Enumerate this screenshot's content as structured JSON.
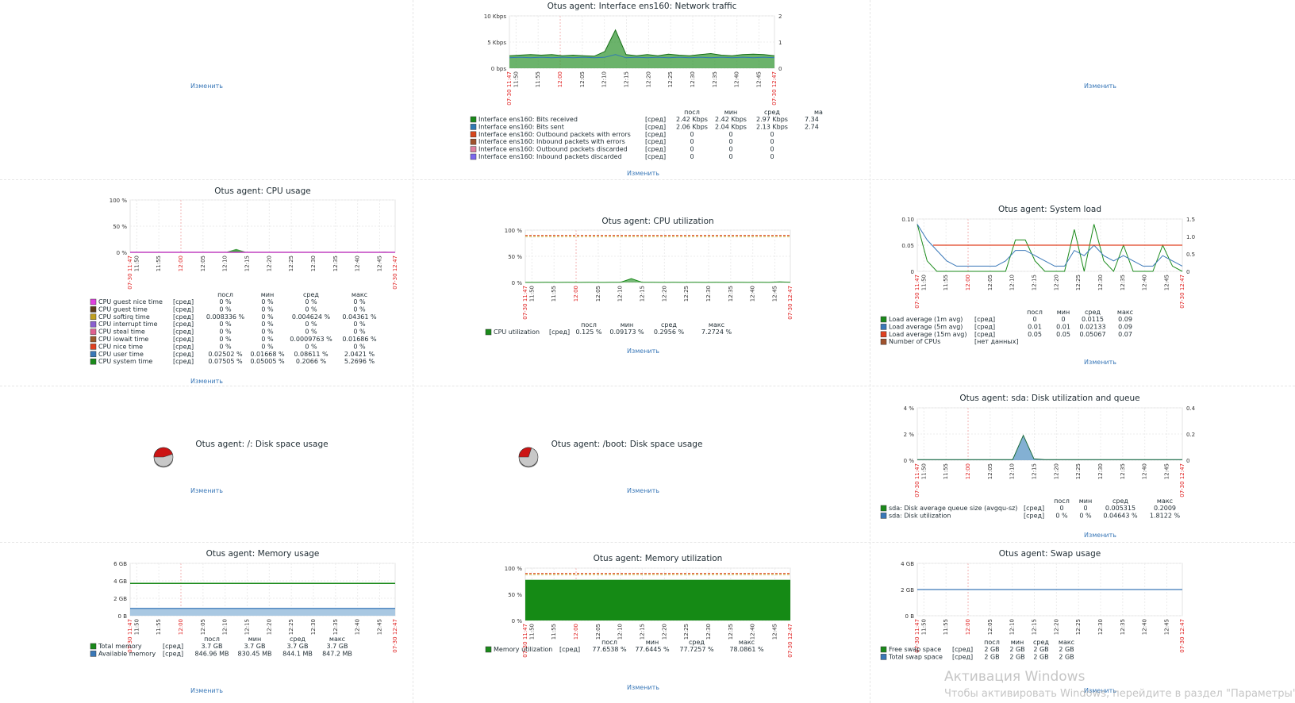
{
  "common": {
    "edit_label": "Изменить",
    "time_start": "07-30 11:47",
    "time_end": "07-30 12:47",
    "time_ticks": [
      "11:50",
      "11:55",
      "12:00",
      "12:05",
      "12:10",
      "12:15",
      "12:20",
      "12:25",
      "12:30",
      "12:35",
      "12:40",
      "12:45"
    ],
    "red_tick": "12:00",
    "func_avg": "[сред]",
    "func_nodata": "[нет данных]",
    "cols": [
      "посл",
      "мин",
      "сред",
      "макс"
    ],
    "col_header_cut": "ма"
  },
  "watermark": {
    "line1": "Активация Windows",
    "line2": "Чтобы активировать Windows, перейдите в раздел \"Параметры\"."
  },
  "charts": {
    "network": {
      "title": "Otus agent: Interface ens160: Network traffic",
      "y_left": [
        "10 Kbps",
        "5 Kbps",
        "0 bps"
      ],
      "y_right": [
        "2",
        "1",
        "0"
      ],
      "ylim_left_kbps": [
        0,
        10
      ],
      "series": [
        {
          "name": "Interface ens160: Bits received",
          "color": "#1a8a1a",
          "values": [
            "2.42 Kbps",
            "2.42 Kbps",
            "2.97 Kbps",
            "7.34"
          ]
        },
        {
          "name": "Interface ens160: Bits sent",
          "color": "#2f79b3",
          "values": [
            "2.06 Kbps",
            "2.04 Kbps",
            "2.13 Kbps",
            "2.74"
          ]
        },
        {
          "name": "Interface ens160: Outbound packets with errors",
          "color": "#d8461c",
          "values": [
            "0",
            "0",
            "0",
            ""
          ]
        },
        {
          "name": "Interface ens160: Inbound packets with errors",
          "color": "#a0522d",
          "values": [
            "0",
            "0",
            "0",
            ""
          ]
        },
        {
          "name": "Interface ens160: Outbound packets discarded",
          "color": "#e07fa0",
          "values": [
            "0",
            "0",
            "0",
            ""
          ]
        },
        {
          "name": "Interface ens160: Inbound packets discarded",
          "color": "#7b68ee",
          "values": [
            "0",
            "0",
            "0",
            ""
          ]
        }
      ],
      "received_kbps": [
        2.4,
        2.5,
        2.6,
        2.5,
        2.6,
        2.4,
        2.5,
        2.4,
        2.3,
        3.2,
        7.3,
        2.6,
        2.4,
        2.6,
        2.4,
        2.7,
        2.5,
        2.4,
        2.6,
        2.8,
        2.5,
        2.4,
        2.6,
        2.7,
        2.6,
        2.4
      ],
      "sent_kbps": [
        2.0,
        2.1,
        2.0,
        2.1,
        2.0,
        2.1,
        2.0,
        2.1,
        2.0,
        2.1,
        2.6,
        2.0,
        2.1,
        2.0,
        2.1,
        2.0,
        2.1,
        2.0,
        2.1,
        2.0,
        2.1,
        2.0,
        2.1,
        2.0,
        2.1,
        2.0
      ]
    },
    "cpu_usage": {
      "title": "Otus agent: CPU usage",
      "y_left": [
        "100 %",
        "50 %",
        "0 %"
      ],
      "series": [
        {
          "name": "CPU guest nice time",
          "color": "#e040e0",
          "values": [
            "0 %",
            "0 %",
            "0 %",
            "0 %"
          ]
        },
        {
          "name": "CPU guest time",
          "color": "#5a3a1a",
          "values": [
            "0 %",
            "0 %",
            "0 %",
            "0 %"
          ]
        },
        {
          "name": "CPU softirq time",
          "color": "#c0a020",
          "values": [
            "0.008336 %",
            "0 %",
            "0.004624 %",
            "0.04361 %"
          ]
        },
        {
          "name": "CPU interrupt time",
          "color": "#8a60d0",
          "values": [
            "0 %",
            "0 %",
            "0 %",
            "0 %"
          ]
        },
        {
          "name": "CPU steal time",
          "color": "#e06090",
          "values": [
            "0 %",
            "0 %",
            "0 %",
            "0 %"
          ]
        },
        {
          "name": "CPU iowait time",
          "color": "#9a5a2a",
          "values": [
            "0 %",
            "0 %",
            "0.0009763 %",
            "0.01686 %"
          ]
        },
        {
          "name": "CPU nice time",
          "color": "#e04020",
          "values": [
            "0 %",
            "0 %",
            "0 %",
            "0 %"
          ]
        },
        {
          "name": "CPU user time",
          "color": "#3a78b8",
          "values": [
            "0.02502 %",
            "0.01668 %",
            "0.08611 %",
            "2.0421 %"
          ]
        },
        {
          "name": "CPU system time",
          "color": "#1a8a1a",
          "values": [
            "0.07505 %",
            "0.05005 %",
            "0.2066 %",
            "5.2696 %"
          ]
        }
      ],
      "total_pct": [
        0.1,
        0.1,
        0.1,
        0.1,
        0.1,
        0.1,
        0.1,
        0.1,
        0.2,
        0.2,
        6.5,
        0.2,
        0.1,
        0.1,
        0.1,
        0.1,
        0.1,
        0.1,
        0.1,
        0.1,
        0.1,
        0.1,
        0.1,
        0.1,
        1.2,
        0.2
      ]
    },
    "cpu_util": {
      "title": "Otus agent: CPU utilization",
      "y_left": [
        "100 %",
        "50 %",
        "0 %"
      ],
      "threshold_pct": 90,
      "series": [
        {
          "name": "CPU utilization",
          "color": "#1a8a1a",
          "values": [
            "0.125 %",
            "0.09173 %",
            "0.2956 %",
            "7.2724 %"
          ]
        }
      ],
      "values_pct": [
        0.2,
        0.2,
        0.3,
        0.2,
        0.3,
        0.2,
        0.3,
        0.2,
        0.3,
        0.4,
        7.2,
        0.4,
        0.3,
        0.2,
        0.3,
        0.2,
        0.3,
        0.2,
        0.3,
        0.2,
        0.3,
        0.2,
        0.3,
        0.2,
        1.2,
        0.3
      ]
    },
    "system_load": {
      "title": "Otus agent: System load",
      "y_left": [
        "0.10",
        "0.05",
        "0"
      ],
      "y_right": [
        "1.5",
        "1.0",
        "0.5",
        "0"
      ],
      "series": [
        {
          "name": "Load average (1m avg)",
          "color": "#1a8a1a",
          "values": [
            "0",
            "0",
            "0.0115",
            "0.09"
          ]
        },
        {
          "name": "Load average (5m avg)",
          "color": "#3a78b8",
          "values": [
            "0.01",
            "0.01",
            "0.02133",
            "0.09"
          ]
        },
        {
          "name": "Load average (15m avg)",
          "color": "#e04020",
          "values": [
            "0.05",
            "0.05",
            "0.05067",
            "0.07"
          ]
        },
        {
          "name": "Number of CPUs",
          "color": "#a0522d",
          "values": [
            "[нет данных]",
            "",
            "",
            ""
          ]
        }
      ],
      "load1": [
        0.09,
        0.02,
        0,
        0,
        0,
        0,
        0,
        0,
        0,
        0,
        0.06,
        0.06,
        0.02,
        0,
        0,
        0,
        0.08,
        0,
        0.09,
        0.02,
        0,
        0.05,
        0,
        0,
        0,
        0.05,
        0.01,
        0
      ],
      "load5": [
        0.09,
        0.06,
        0.04,
        0.02,
        0.01,
        0.01,
        0.01,
        0.01,
        0.01,
        0.02,
        0.04,
        0.04,
        0.03,
        0.02,
        0.01,
        0.01,
        0.04,
        0.03,
        0.05,
        0.03,
        0.02,
        0.03,
        0.02,
        0.01,
        0.01,
        0.03,
        0.02,
        0.01
      ],
      "load15_const": 0.05
    },
    "disk_root": {
      "title": "Otus agent: /: Disk space usage",
      "used_fraction": 0.45
    },
    "disk_boot": {
      "title": "Otus agent: /boot: Disk space usage",
      "used_fraction": 0.3
    },
    "sda": {
      "title": "Otus agent: sda: Disk utilization and queue",
      "y_left": [
        "4 %",
        "2 %",
        "0 %"
      ],
      "y_right": [
        "0.4",
        "0.2",
        "0"
      ],
      "series": [
        {
          "name": "sda: Disk average queue size (avgqu-sz)",
          "color": "#1a8a1a",
          "values": [
            "0",
            "0",
            "0.005315",
            "0.2009"
          ]
        },
        {
          "name": "sda: Disk utilization",
          "color": "#3a78b8",
          "values": [
            "0 %",
            "0 %",
            "0.04643 %",
            "1.8122 %"
          ]
        }
      ],
      "util_pct": [
        0.05,
        0.05,
        0.05,
        0.05,
        0.05,
        0.05,
        0.05,
        0.05,
        0.05,
        0.05,
        1.9,
        0.1,
        0.05,
        0.05,
        0.05,
        0.05,
        0.05,
        0.05,
        0.05,
        0.05,
        0.05,
        0.05,
        0.05,
        0.05,
        0.05,
        0.05
      ]
    },
    "memory_usage": {
      "title": "Otus agent: Memory usage",
      "y_left": [
        "6 GB",
        "4 GB",
        "2 GB",
        "0 B"
      ],
      "total_gb": 3.7,
      "available_gb": 0.84,
      "series": [
        {
          "name": "Total memory",
          "color": "#1a8a1a",
          "values": [
            "3.7 GB",
            "3.7 GB",
            "3.7 GB",
            "3.7 GB"
          ]
        },
        {
          "name": "Available memory",
          "color": "#3a78b8",
          "values": [
            "846.96 MB",
            "830.45 MB",
            "844.1 MB",
            "847.2 MB"
          ]
        }
      ]
    },
    "memory_util": {
      "title": "Otus agent: Memory utilization",
      "y_left": [
        "100 %",
        "50 %",
        "0 %"
      ],
      "threshold_pct": 90,
      "value_pct": 77.7,
      "series": [
        {
          "name": "Memory utilization",
          "color": "#1a8a1a",
          "values": [
            "77.6538 %",
            "77.6445 %",
            "77.7257 %",
            "78.0861 %"
          ]
        }
      ]
    },
    "swap": {
      "title": "Otus agent: Swap usage",
      "y_left": [
        "4 GB",
        "2 GB",
        "0 B"
      ],
      "value_gb": 2,
      "series": [
        {
          "name": "Free swap space",
          "color": "#1a8a1a",
          "values": [
            "2 GB",
            "2 GB",
            "2 GB",
            "2 GB"
          ]
        },
        {
          "name": "Total swap space",
          "color": "#3a78b8",
          "values": [
            "2 GB",
            "2 GB",
            "2 GB",
            "2 GB"
          ]
        }
      ]
    }
  }
}
